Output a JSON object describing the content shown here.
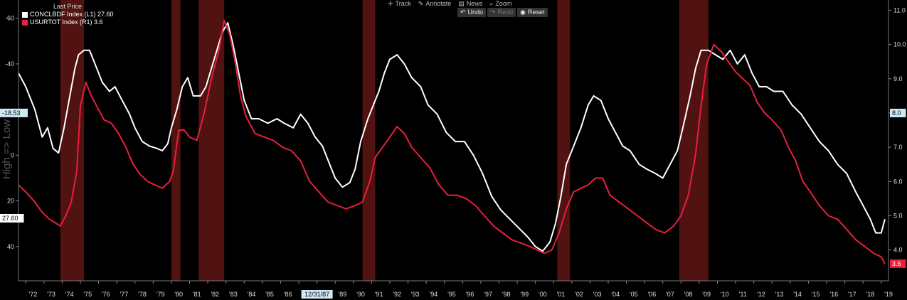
{
  "legend": {
    "header": "Last Price",
    "series": [
      {
        "label": "CONCLBDF Index  (L1) 27.60",
        "color": "#ffffff"
      },
      {
        "label": "USURTOT Index  (R1)   3.6",
        "color": "#e8203c"
      }
    ]
  },
  "toolbar": {
    "track": "Track",
    "annotate": "Annotate",
    "news": "News",
    "zoom": "Zoom",
    "undo": "Undo",
    "redo": "Redo",
    "reset": "Reset",
    "track_icon": "crosshair-icon",
    "annotate_icon": "pencil-icon",
    "news_icon": "news-icon",
    "zoom_icon": "magnifier-icon",
    "undo_icon": "undo-icon",
    "redo_icon": "redo-icon",
    "reset_icon": "reset-icon"
  },
  "chart_data": {
    "type": "line",
    "ylabel_left": "High => Low",
    "left_axis": {
      "inverted": true,
      "range": [
        -68,
        55
      ],
      "ticks": [
        -60,
        -40,
        -20,
        0,
        20,
        40
      ],
      "tick_labels": [
        "-60",
        "-40",
        "",
        "0",
        "20",
        "40"
      ]
    },
    "right_axis": {
      "range": [
        3.1,
        11.3
      ],
      "ticks": [
        3.0,
        4.0,
        5.0,
        6.0,
        7.0,
        8.0,
        9.0,
        10.0,
        11.0
      ],
      "tick_labels": [
        "3.0",
        "4.0",
        "5.0",
        "6.0",
        "7.0",
        "8.0",
        "9.0",
        "10.0",
        "11.0"
      ]
    },
    "x_range": [
      1971.6,
      2019.4
    ],
    "x_tick_labels": [
      "'72",
      "'73",
      "'74",
      "'75",
      "'76",
      "'77",
      "'78",
      "'79",
      "'80",
      "'81",
      "'82",
      "'83",
      "'84",
      "'85",
      "'86",
      "",
      "'88",
      "'89",
      "'90",
      "'91",
      "'92",
      "'93",
      "'94",
      "'95",
      "'96",
      "'97",
      "'98",
      "'99",
      "'00",
      "'01",
      "'02",
      "'03",
      "'04",
      "'05",
      "'06",
      "'07",
      "'08",
      "'09",
      "'10",
      "'11",
      "'12",
      "'13",
      "'14",
      "'15",
      "'16",
      "'17",
      "'18",
      "'19"
    ],
    "x_cursor_label": "12/31/87",
    "last_value_tags": [
      {
        "axis": "left",
        "value": -18.53,
        "label": "-18.53",
        "bg": "#cfe8f5",
        "color": "#000"
      },
      {
        "axis": "left",
        "value": 27.6,
        "label": "27.60",
        "bg": "#ffffff",
        "color": "#000"
      },
      {
        "axis": "right",
        "value": 8.0,
        "label": "8.0",
        "bg": "#cfe8f5",
        "color": "#000"
      },
      {
        "axis": "right",
        "value": 3.6,
        "label": "3.6",
        "bg": "#e8203c",
        "color": "#fff"
      }
    ],
    "recessions": [
      [
        1973.9,
        1975.2
      ],
      [
        1980.0,
        1980.5
      ],
      [
        1981.5,
        1982.9
      ],
      [
        1990.5,
        1991.2
      ],
      [
        2001.2,
        2001.9
      ],
      [
        2007.9,
        2009.5
      ]
    ],
    "series": [
      {
        "name": "CONCLBDF Index",
        "axis": "left",
        "color": "#ffffff",
        "points": [
          [
            1971.6,
            -36
          ],
          [
            1972.0,
            -30
          ],
          [
            1972.5,
            -20
          ],
          [
            1972.9,
            -8
          ],
          [
            1973.2,
            -12
          ],
          [
            1973.5,
            -3
          ],
          [
            1973.8,
            -1
          ],
          [
            1974.1,
            -12
          ],
          [
            1974.4,
            -25
          ],
          [
            1974.7,
            -38
          ],
          [
            1974.9,
            -44
          ],
          [
            1975.2,
            -46
          ],
          [
            1975.5,
            -46
          ],
          [
            1975.8,
            -40
          ],
          [
            1976.2,
            -32
          ],
          [
            1976.6,
            -28
          ],
          [
            1976.9,
            -30
          ],
          [
            1977.3,
            -24
          ],
          [
            1977.7,
            -18
          ],
          [
            1978.0,
            -12
          ],
          [
            1978.4,
            -6
          ],
          [
            1978.8,
            -4
          ],
          [
            1979.2,
            -3
          ],
          [
            1979.5,
            -2
          ],
          [
            1979.8,
            -5
          ],
          [
            1980.0,
            -12
          ],
          [
            1980.3,
            -20
          ],
          [
            1980.6,
            -30
          ],
          [
            1980.9,
            -34
          ],
          [
            1981.2,
            -26
          ],
          [
            1981.6,
            -26
          ],
          [
            1981.9,
            -30
          ],
          [
            1982.2,
            -38
          ],
          [
            1982.5,
            -46
          ],
          [
            1982.8,
            -54
          ],
          [
            1983.1,
            -58
          ],
          [
            1983.4,
            -48
          ],
          [
            1983.7,
            -36
          ],
          [
            1984.0,
            -24
          ],
          [
            1984.4,
            -16
          ],
          [
            1984.8,
            -16
          ],
          [
            1985.3,
            -14
          ],
          [
            1985.8,
            -16
          ],
          [
            1986.2,
            -14
          ],
          [
            1986.7,
            -12
          ],
          [
            1987.1,
            -18
          ],
          [
            1987.5,
            -14
          ],
          [
            1987.9,
            -8
          ],
          [
            1988.3,
            -4
          ],
          [
            1988.7,
            4
          ],
          [
            1989.0,
            10
          ],
          [
            1989.4,
            14
          ],
          [
            1989.8,
            12
          ],
          [
            1990.1,
            6
          ],
          [
            1990.4,
            -6
          ],
          [
            1990.8,
            -16
          ],
          [
            1991.1,
            -22
          ],
          [
            1991.4,
            -28
          ],
          [
            1991.7,
            -36
          ],
          [
            1992.0,
            -42
          ],
          [
            1992.4,
            -44
          ],
          [
            1992.8,
            -40
          ],
          [
            1993.2,
            -34
          ],
          [
            1993.7,
            -30
          ],
          [
            1994.1,
            -22
          ],
          [
            1994.6,
            -18
          ],
          [
            1995.1,
            -10
          ],
          [
            1995.6,
            -6
          ],
          [
            1996.1,
            -6
          ],
          [
            1996.6,
            0
          ],
          [
            1997.1,
            8
          ],
          [
            1997.6,
            18
          ],
          [
            1998.1,
            24
          ],
          [
            1998.6,
            28
          ],
          [
            1999.1,
            32
          ],
          [
            1999.6,
            36
          ],
          [
            2000.0,
            40
          ],
          [
            2000.4,
            42
          ],
          [
            2000.8,
            38
          ],
          [
            2001.1,
            30
          ],
          [
            2001.4,
            18
          ],
          [
            2001.7,
            4
          ],
          [
            2002.1,
            -4
          ],
          [
            2002.5,
            -12
          ],
          [
            2002.9,
            -22
          ],
          [
            2003.2,
            -26
          ],
          [
            2003.6,
            -24
          ],
          [
            2004.0,
            -16
          ],
          [
            2004.4,
            -10
          ],
          [
            2004.8,
            -4
          ],
          [
            2005.2,
            -2
          ],
          [
            2005.7,
            4
          ],
          [
            2006.1,
            6
          ],
          [
            2006.6,
            8
          ],
          [
            2007.0,
            10
          ],
          [
            2007.4,
            4
          ],
          [
            2007.8,
            -2
          ],
          [
            2008.1,
            -12
          ],
          [
            2008.5,
            -26
          ],
          [
            2008.8,
            -38
          ],
          [
            2009.1,
            -46
          ],
          [
            2009.5,
            -46
          ],
          [
            2009.9,
            -44
          ],
          [
            2010.3,
            -42
          ],
          [
            2010.7,
            -46
          ],
          [
            2011.1,
            -40
          ],
          [
            2011.5,
            -44
          ],
          [
            2011.9,
            -36
          ],
          [
            2012.3,
            -30
          ],
          [
            2012.7,
            -30
          ],
          [
            2013.1,
            -28
          ],
          [
            2013.6,
            -28
          ],
          [
            2014.1,
            -22
          ],
          [
            2014.6,
            -18
          ],
          [
            2015.1,
            -12
          ],
          [
            2015.6,
            -6
          ],
          [
            2016.1,
            -2
          ],
          [
            2016.6,
            4
          ],
          [
            2017.1,
            8
          ],
          [
            2017.6,
            16
          ],
          [
            2018.0,
            22
          ],
          [
            2018.4,
            28
          ],
          [
            2018.7,
            34
          ],
          [
            2019.0,
            34
          ],
          [
            2019.2,
            28
          ]
        ]
      },
      {
        "name": "USURTOT Index",
        "axis": "right",
        "color": "#e8203c",
        "points": [
          [
            1971.6,
            5.9
          ],
          [
            1972.0,
            5.7
          ],
          [
            1972.5,
            5.4
          ],
          [
            1972.9,
            5.1
          ],
          [
            1973.3,
            4.9
          ],
          [
            1973.6,
            4.8
          ],
          [
            1973.9,
            4.7
          ],
          [
            1974.2,
            5.0
          ],
          [
            1974.5,
            5.4
          ],
          [
            1974.8,
            6.3
          ],
          [
            1975.0,
            8.2
          ],
          [
            1975.3,
            8.9
          ],
          [
            1975.6,
            8.5
          ],
          [
            1975.9,
            8.2
          ],
          [
            1976.3,
            7.8
          ],
          [
            1976.7,
            7.7
          ],
          [
            1977.1,
            7.4
          ],
          [
            1977.5,
            7.0
          ],
          [
            1977.9,
            6.5
          ],
          [
            1978.3,
            6.2
          ],
          [
            1978.7,
            6.0
          ],
          [
            1979.1,
            5.9
          ],
          [
            1979.5,
            5.8
          ],
          [
            1979.9,
            6.0
          ],
          [
            1980.1,
            6.3
          ],
          [
            1980.4,
            7.5
          ],
          [
            1980.7,
            7.5
          ],
          [
            1981.0,
            7.3
          ],
          [
            1981.4,
            7.2
          ],
          [
            1981.8,
            8.0
          ],
          [
            1982.2,
            9.0
          ],
          [
            1982.6,
            9.8
          ],
          [
            1982.9,
            10.7
          ],
          [
            1983.2,
            10.3
          ],
          [
            1983.5,
            9.5
          ],
          [
            1983.8,
            8.5
          ],
          [
            1984.1,
            7.9
          ],
          [
            1984.6,
            7.4
          ],
          [
            1985.1,
            7.3
          ],
          [
            1985.6,
            7.2
          ],
          [
            1986.1,
            7.0
          ],
          [
            1986.6,
            6.9
          ],
          [
            1987.1,
            6.6
          ],
          [
            1987.6,
            6.0
          ],
          [
            1988.1,
            5.7
          ],
          [
            1988.6,
            5.4
          ],
          [
            1989.1,
            5.3
          ],
          [
            1989.6,
            5.2
          ],
          [
            1990.1,
            5.3
          ],
          [
            1990.5,
            5.4
          ],
          [
            1990.9,
            6.0
          ],
          [
            1991.2,
            6.7
          ],
          [
            1991.6,
            7.0
          ],
          [
            1992.0,
            7.3
          ],
          [
            1992.4,
            7.6
          ],
          [
            1992.8,
            7.4
          ],
          [
            1993.2,
            7.0
          ],
          [
            1993.7,
            6.7
          ],
          [
            1994.2,
            6.4
          ],
          [
            1994.7,
            5.9
          ],
          [
            1995.2,
            5.6
          ],
          [
            1995.7,
            5.6
          ],
          [
            1996.2,
            5.5
          ],
          [
            1996.7,
            5.3
          ],
          [
            1997.2,
            5.0
          ],
          [
            1997.7,
            4.7
          ],
          [
            1998.2,
            4.5
          ],
          [
            1998.7,
            4.3
          ],
          [
            1999.2,
            4.2
          ],
          [
            1999.7,
            4.1
          ],
          [
            2000.1,
            4.0
          ],
          [
            2000.5,
            3.9
          ],
          [
            2000.9,
            4.0
          ],
          [
            2001.3,
            4.5
          ],
          [
            2001.7,
            5.2
          ],
          [
            2002.1,
            5.7
          ],
          [
            2002.5,
            5.8
          ],
          [
            2002.9,
            5.9
          ],
          [
            2003.3,
            6.1
          ],
          [
            2003.7,
            6.1
          ],
          [
            2004.1,
            5.6
          ],
          [
            2004.6,
            5.4
          ],
          [
            2005.1,
            5.2
          ],
          [
            2005.6,
            5.0
          ],
          [
            2006.1,
            4.8
          ],
          [
            2006.6,
            4.6
          ],
          [
            2007.1,
            4.5
          ],
          [
            2007.6,
            4.7
          ],
          [
            2008.0,
            5.0
          ],
          [
            2008.4,
            5.6
          ],
          [
            2008.8,
            6.8
          ],
          [
            2009.1,
            8.2
          ],
          [
            2009.4,
            9.4
          ],
          [
            2009.8,
            10.0
          ],
          [
            2010.2,
            9.8
          ],
          [
            2010.6,
            9.5
          ],
          [
            2011.0,
            9.2
          ],
          [
            2011.4,
            9.0
          ],
          [
            2011.8,
            8.8
          ],
          [
            2012.2,
            8.3
          ],
          [
            2012.6,
            8.0
          ],
          [
            2013.0,
            7.8
          ],
          [
            2013.5,
            7.5
          ],
          [
            2013.9,
            7.0
          ],
          [
            2014.3,
            6.6
          ],
          [
            2014.7,
            6.0
          ],
          [
            2015.1,
            5.7
          ],
          [
            2015.6,
            5.3
          ],
          [
            2016.1,
            5.0
          ],
          [
            2016.6,
            4.9
          ],
          [
            2017.1,
            4.6
          ],
          [
            2017.6,
            4.3
          ],
          [
            2018.1,
            4.1
          ],
          [
            2018.6,
            3.9
          ],
          [
            2019.0,
            3.8
          ],
          [
            2019.2,
            3.6
          ]
        ]
      }
    ]
  }
}
